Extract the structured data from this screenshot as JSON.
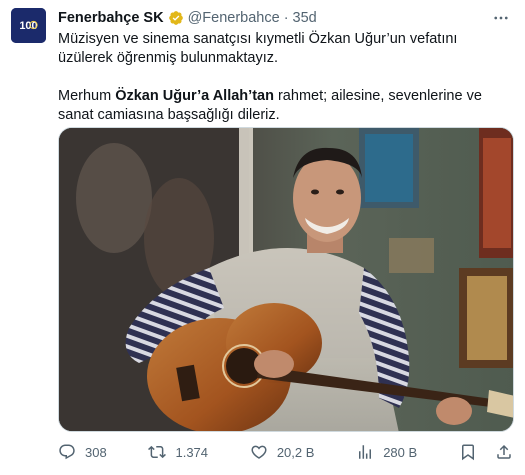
{
  "tweet": {
    "author": {
      "name": "Fenerbahçe SK",
      "handle": "@Fenerbahce",
      "separator": "·",
      "time": "35d",
      "avatar_text": "100",
      "verified_color": "#e2b719"
    },
    "text": {
      "line1": "Müzisyen ve sinema sanatçısı kıymetli Özkan Uğur’un vefatını üzülerek öğrenmiş bulunmaktayız.",
      "line2_prefix": "Merhum ",
      "line2_bold": "Özkan Uğur’a Allah’tan",
      "line2_suffix": " rahmet; ailesine, sevenlerine ve sanat camiasına başsağlığı dileriz."
    },
    "actions": {
      "reply_count": "308",
      "retweet_count": "1.374",
      "like_count": "20,2 B",
      "views_count": "280 B"
    }
  },
  "icons": {
    "verified": "verified-badge-icon",
    "more": "more-options-icon",
    "reply": "reply-icon",
    "retweet": "retweet-icon",
    "like": "heart-icon",
    "views": "views-chart-icon",
    "bookmark": "bookmark-icon",
    "share": "share-icon"
  },
  "colors": {
    "text": "#0f1419",
    "secondary": "#536471",
    "border": "#cfd9de",
    "avatar_bg": "#1b2a6b"
  }
}
